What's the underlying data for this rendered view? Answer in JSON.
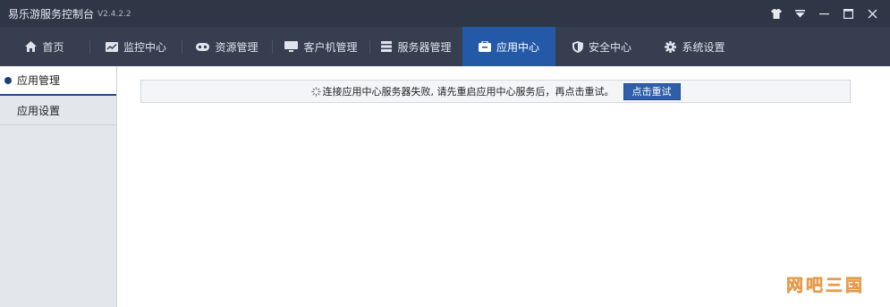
{
  "window": {
    "title": "易乐游服务控制台",
    "version": "V2.4.2.2",
    "controls": [
      "skin-icon",
      "dropdown-icon",
      "minimize-icon",
      "maximize-icon",
      "close-icon"
    ]
  },
  "nav": {
    "items": [
      {
        "label": "首页",
        "icon": "home-icon"
      },
      {
        "label": "监控中心",
        "icon": "monitor-chart-icon"
      },
      {
        "label": "资源管理",
        "icon": "gamepad-icon"
      },
      {
        "label": "客户机管理",
        "icon": "desktop-icon"
      },
      {
        "label": "服务器管理",
        "icon": "server-icon"
      },
      {
        "label": "应用中心",
        "icon": "app-box-icon",
        "active": true
      },
      {
        "label": "安全中心",
        "icon": "shield-icon"
      },
      {
        "label": "系统设置",
        "icon": "gear-icon"
      }
    ],
    "active_color": "#2459a7"
  },
  "sidebar": {
    "items": [
      {
        "label": "应用管理",
        "active": true
      },
      {
        "label": "应用设置",
        "active": false
      }
    ]
  },
  "notice": {
    "message": "连接应用中心服务器失败, 请先重启应用中心服务后，再点击重试。",
    "retry_label": "点击重试",
    "icon": "loading-icon"
  },
  "watermark": "网吧三国"
}
